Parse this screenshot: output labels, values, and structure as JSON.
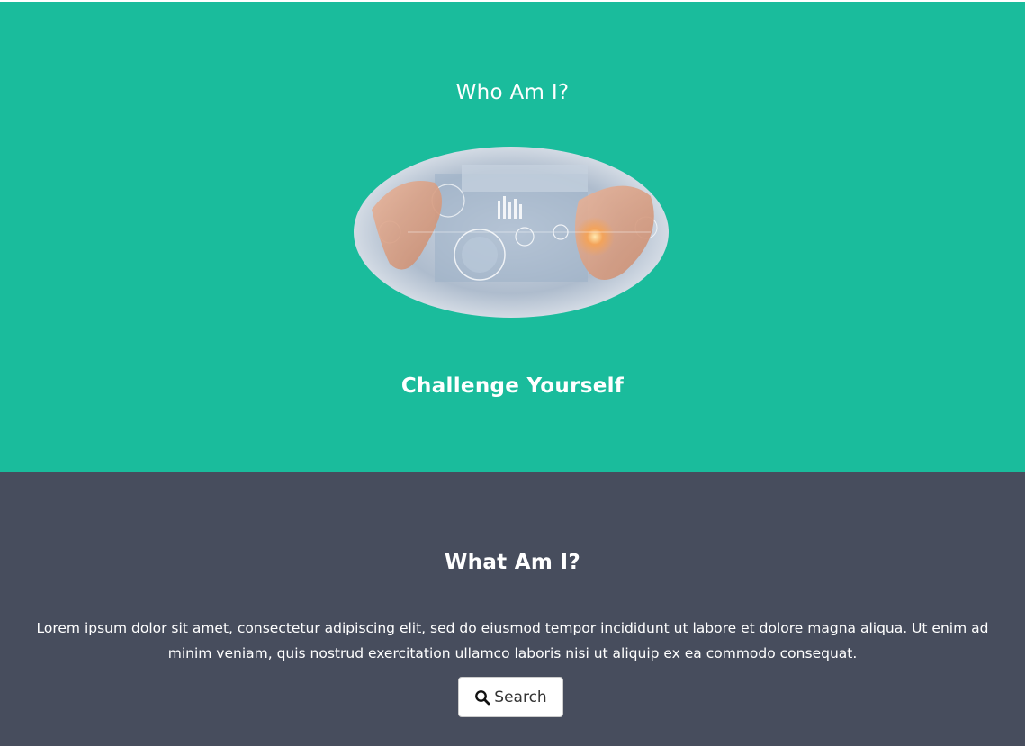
{
  "hero": {
    "title": "Who Am I?",
    "subtitle": "Challenge Yourself",
    "image_icon": "hands-holographic-interface-image"
  },
  "about": {
    "title": "What Am I?",
    "text": "Lorem ipsum dolor sit amet, consectetur adipiscing elit, sed do eiusmod tempor incididunt ut labore et dolore magna aliqua. Ut enim ad minim veniam, quis nostrud exercitation ullamco laboris nisi ut aliquip ex ea commodo consequat.",
    "search_label": "Search",
    "search_icon": "search-icon"
  },
  "colors": {
    "teal": "#1abc9c",
    "slate": "#474d5d",
    "white": "#ffffff"
  }
}
